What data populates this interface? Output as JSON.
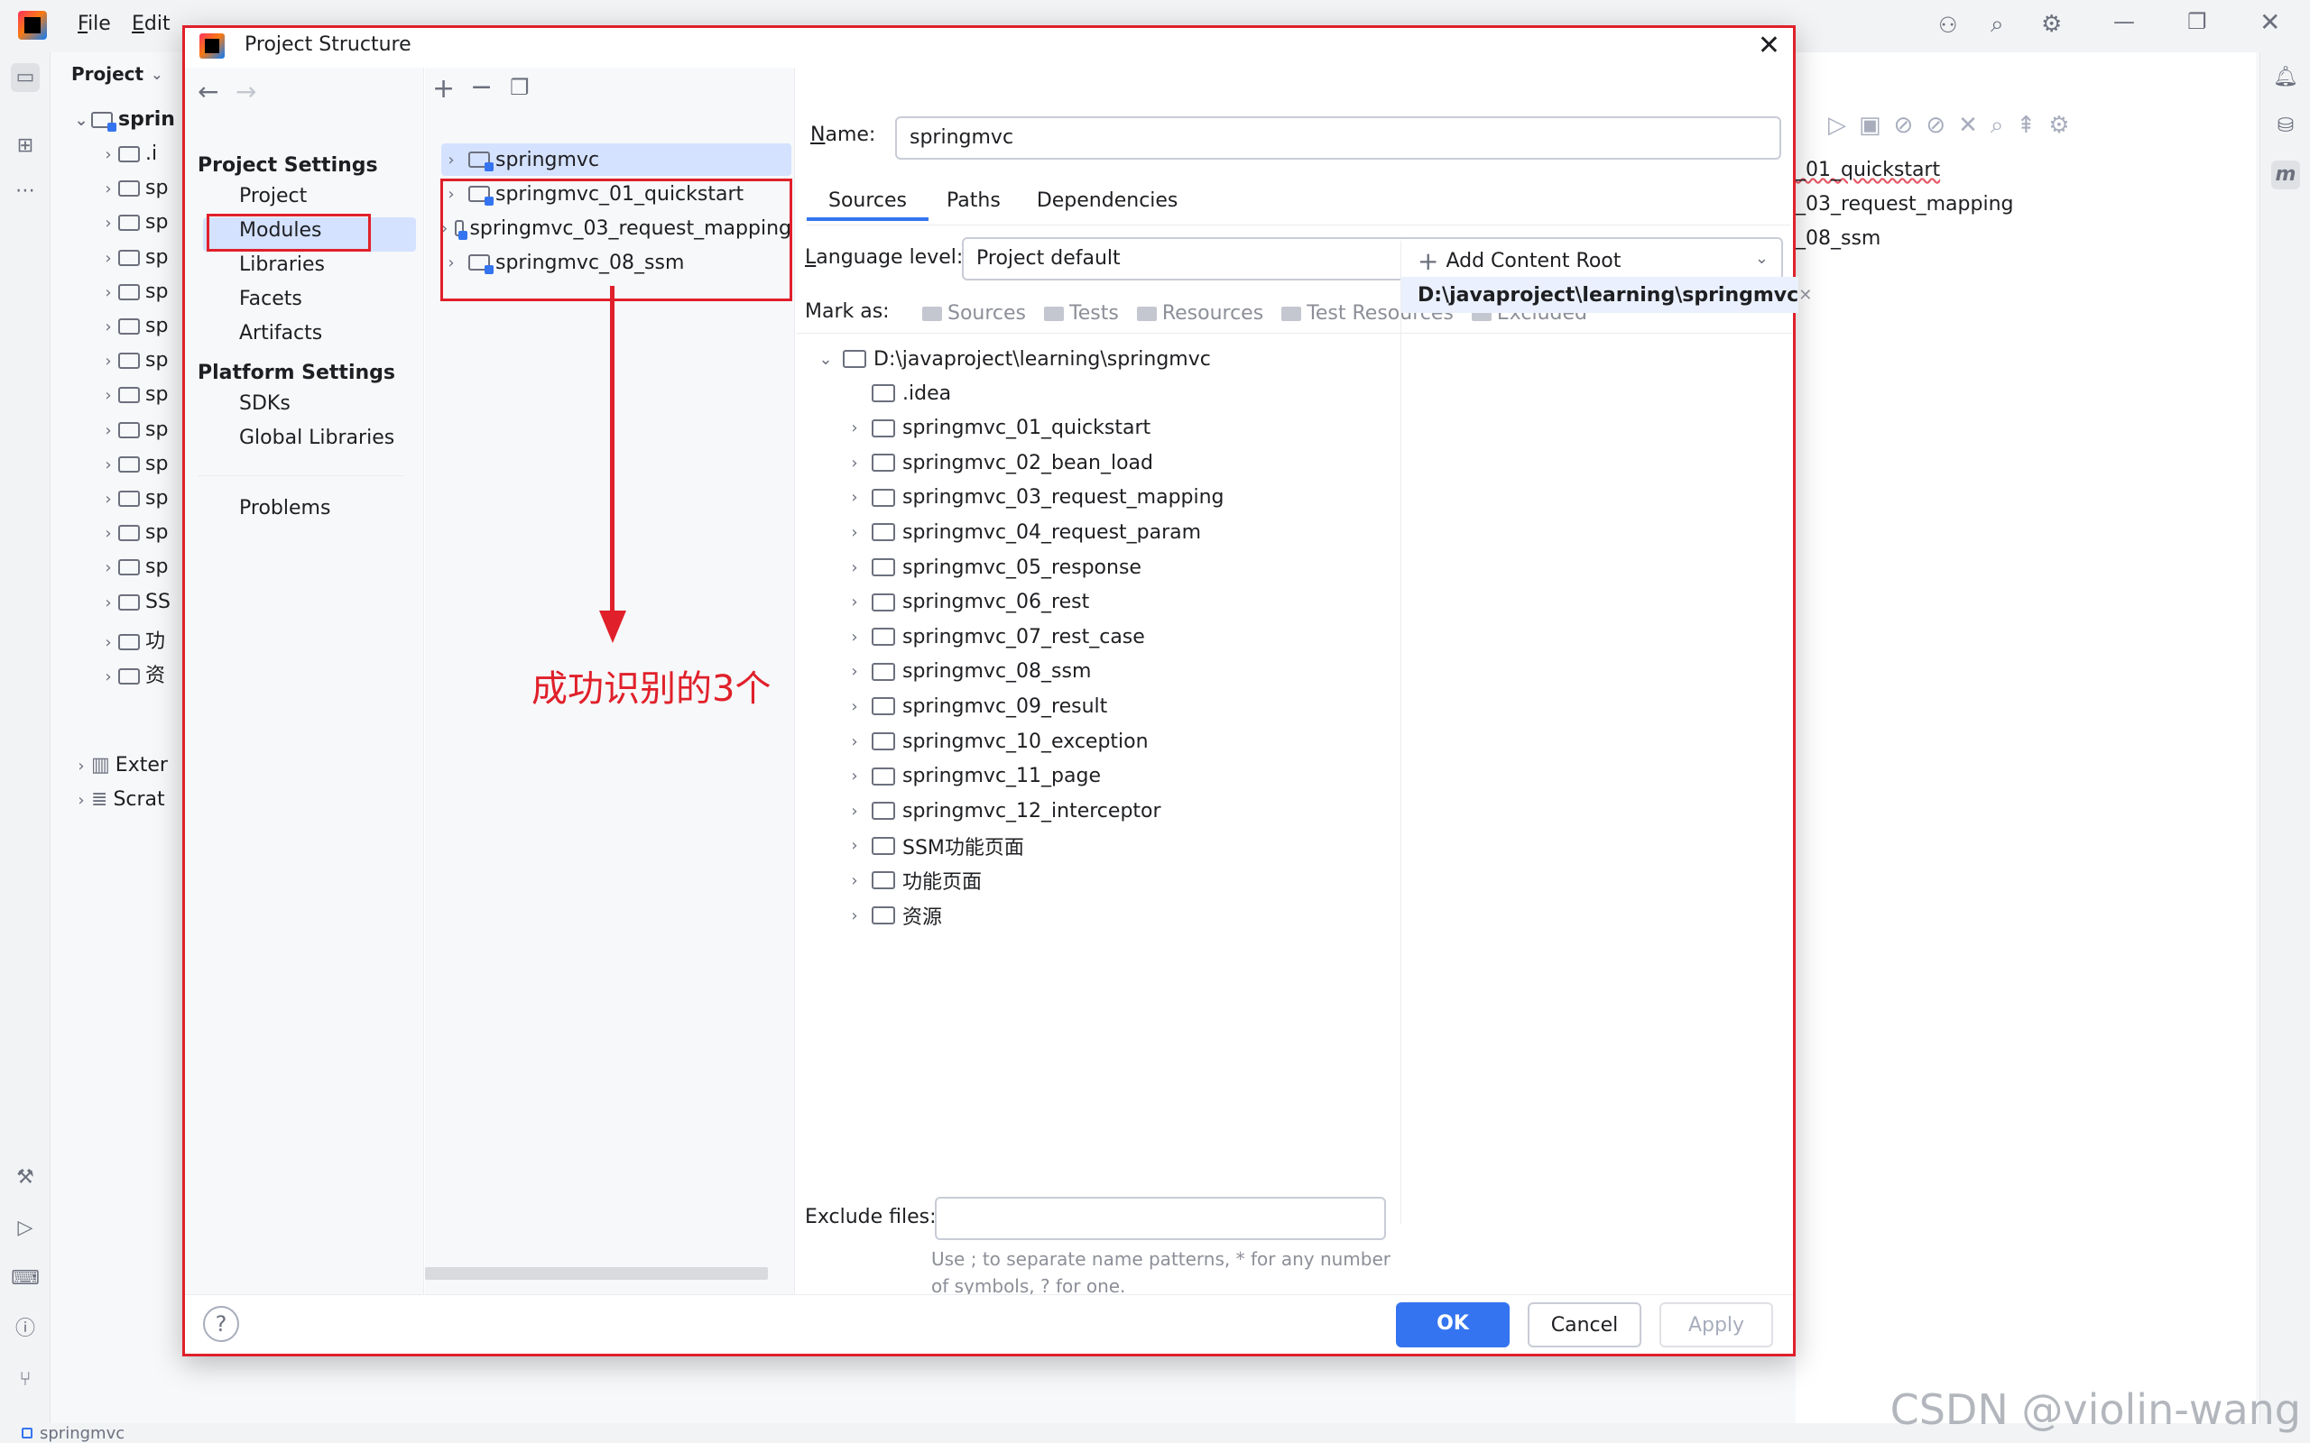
{
  "ide": {
    "menu": [
      {
        "label": "File",
        "mnemonic": "F"
      },
      {
        "label": "Edit",
        "mnemonic": "E"
      }
    ],
    "project_panel_title": "Project",
    "project_root_label": "sprin",
    "tree_stubs": [
      ".i",
      "sp",
      "sp",
      "sp",
      "sp",
      "sp",
      "sp",
      "sp",
      "sp",
      "sp",
      "sp",
      "sp",
      "sp",
      "SS",
      "功",
      "资"
    ],
    "external_label": "Exter",
    "scratches_label": "Scrat",
    "editor_lines": [
      "_01_quickstart",
      "_03_request_mapping",
      "_08_ssm"
    ],
    "status_text": "springmvc",
    "watermark": "CSDN @violin-wang"
  },
  "dialog": {
    "title": "Project Structure",
    "close_icon": "close-icon",
    "nav": {
      "project_settings_header": "Project Settings",
      "project_settings": [
        "Project",
        "Modules",
        "Libraries",
        "Facets",
        "Artifacts"
      ],
      "platform_settings_header": "Platform Settings",
      "platform_settings": [
        "SDKs",
        "Global Libraries"
      ],
      "problems": "Problems",
      "selected": "Modules"
    },
    "modules": {
      "add_icon": "add-icon",
      "remove_icon": "remove-icon",
      "copy_icon": "copy-icon",
      "items": [
        "springmvc",
        "springmvc_01_quickstart",
        "springmvc_03_request_mapping",
        "springmvc_08_ssm"
      ],
      "selected": "springmvc"
    },
    "annotation": "成功识别的3个",
    "details": {
      "name_label": "Name:",
      "name_value": "springmvc",
      "tabs": [
        "Sources",
        "Paths",
        "Dependencies"
      ],
      "active_tab": "Sources",
      "language_level_label": "Language level:",
      "language_level_value": "Project default",
      "mark_as_label": "Mark as:",
      "mark_as_buttons": [
        "Sources",
        "Tests",
        "Resources",
        "Test Resources",
        "Excluded"
      ],
      "content_tree_root": "D:\\javaproject\\learning\\springmvc",
      "content_tree_children": [
        {
          "name": ".idea",
          "expandable": false
        },
        {
          "name": "springmvc_01_quickstart",
          "expandable": true
        },
        {
          "name": "springmvc_02_bean_load",
          "expandable": true
        },
        {
          "name": "springmvc_03_request_mapping",
          "expandable": true
        },
        {
          "name": "springmvc_04_request_param",
          "expandable": true
        },
        {
          "name": "springmvc_05_response",
          "expandable": true
        },
        {
          "name": "springmvc_06_rest",
          "expandable": true
        },
        {
          "name": "springmvc_07_rest_case",
          "expandable": true
        },
        {
          "name": "springmvc_08_ssm",
          "expandable": true
        },
        {
          "name": "springmvc_09_result",
          "expandable": true
        },
        {
          "name": "springmvc_10_exception",
          "expandable": true
        },
        {
          "name": "springmvc_11_page",
          "expandable": true
        },
        {
          "name": "springmvc_12_interceptor",
          "expandable": true
        },
        {
          "name": "SSM功能页面",
          "expandable": true
        },
        {
          "name": "功能页面",
          "expandable": true
        },
        {
          "name": "资源",
          "expandable": true
        }
      ],
      "add_content_root": "Add Content Root",
      "content_root_path": "D:\\javaproject\\learning\\springmvc",
      "exclude_files_label": "Exclude files:",
      "exclude_files_value": "",
      "exclude_hint": "Use ; to separate name patterns, * for any number of symbols, ? for one."
    },
    "footer": {
      "help": "?",
      "ok": "OK",
      "cancel": "Cancel",
      "apply": "Apply"
    }
  },
  "colors": {
    "accent": "#3574f0",
    "annotation_red": "#e0202a",
    "selection": "#d4e2ff"
  }
}
